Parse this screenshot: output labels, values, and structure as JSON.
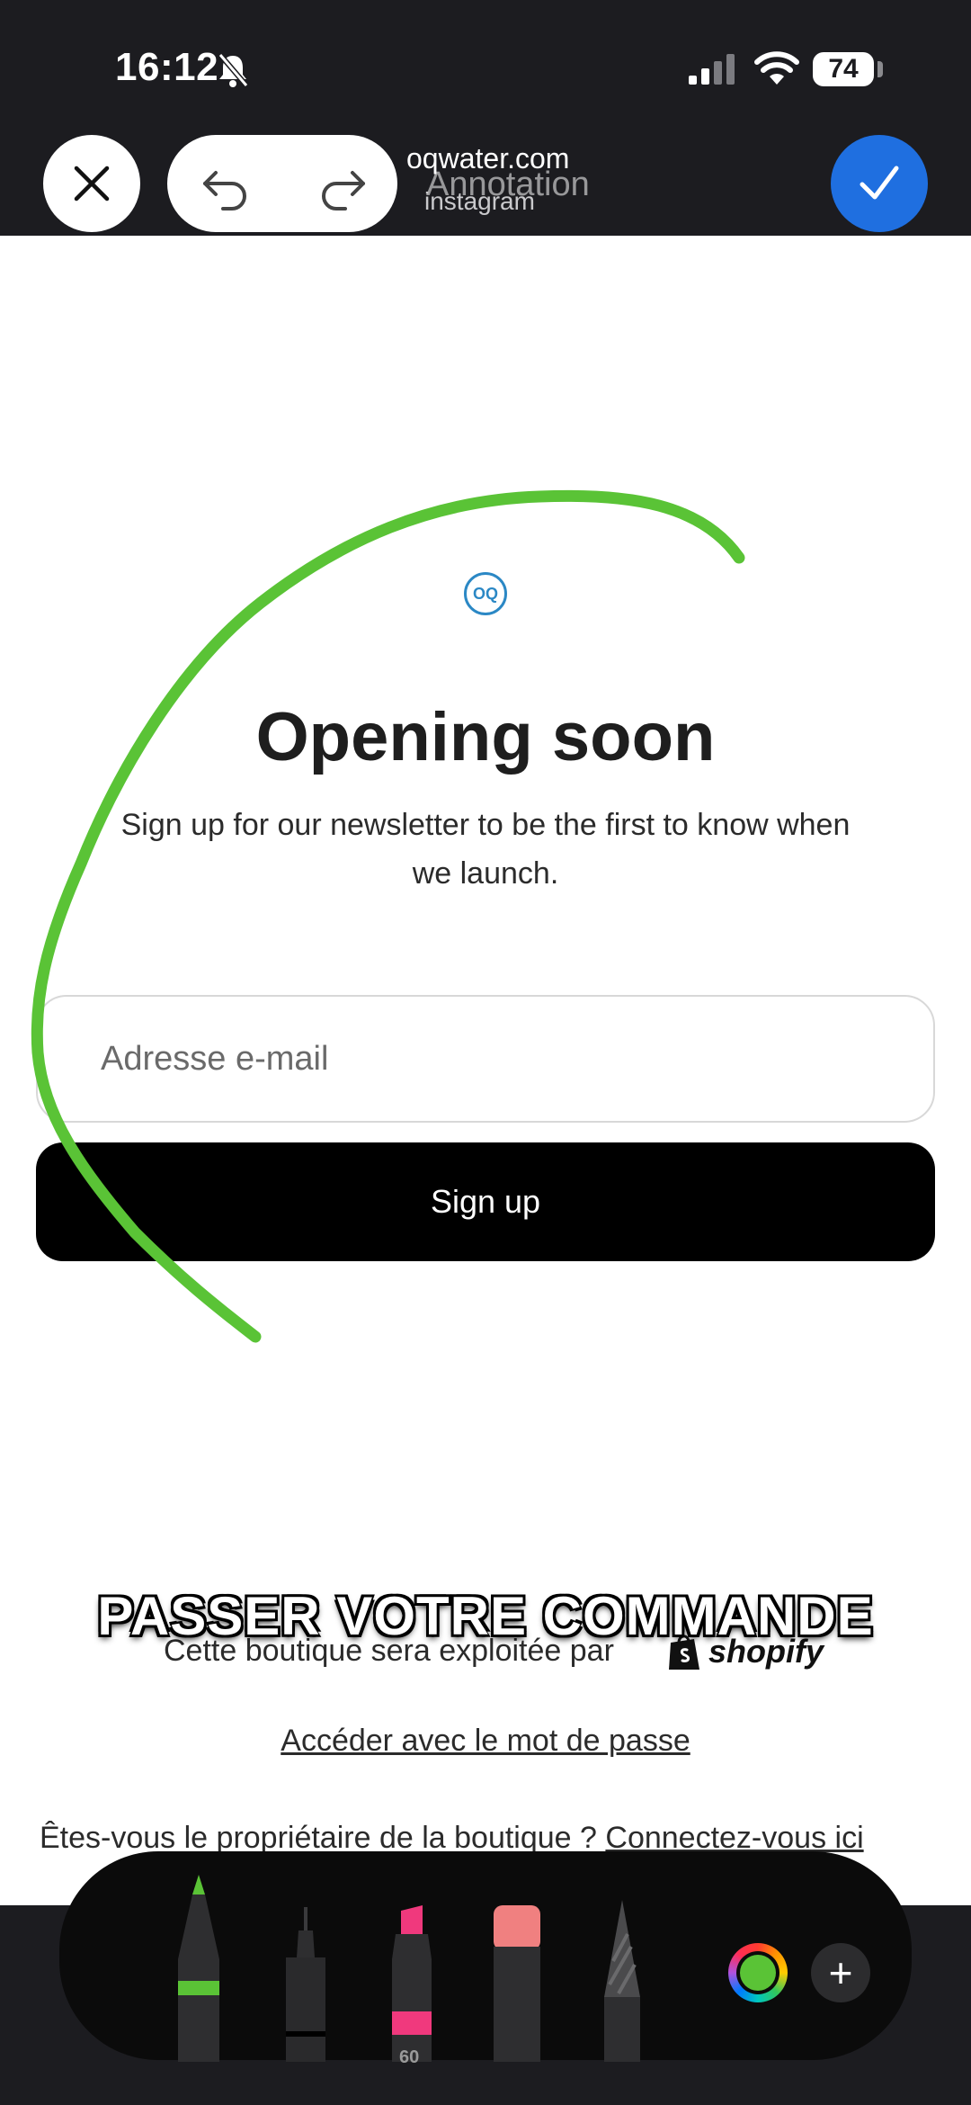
{
  "status_bar": {
    "time": "16:12",
    "battery": "74",
    "icons": [
      "bell-slash-icon",
      "signal-icon",
      "wifi-icon",
      "battery-icon"
    ]
  },
  "markup_toolbar": {
    "domain": "oqwater.com",
    "title": "Annotation",
    "source": "instagram",
    "icons": [
      "close-icon",
      "undo-icon",
      "redo-icon",
      "checkmark-icon"
    ],
    "done_color": "#1f6fe0"
  },
  "page": {
    "logo_text": "OQ",
    "headline": "Opening soon",
    "subtitle": "Sign up for our newsletter to be the first to know when we launch.",
    "email_placeholder": "Adresse e-mail",
    "signup_label": "Sign up",
    "shop_text": "Cette boutique sera exploitée par",
    "shopify_label": "shopify",
    "password_link": "Accéder avec le mot de passe",
    "owner_text": "Êtes-vous le propriétaire de la boutique ?",
    "owner_link": "Connectez-vous ici"
  },
  "overlay": {
    "caption": "PASSER VOTRE COMMANDE",
    "annotation_color": "#5ac336"
  },
  "tool_palette": {
    "tools": [
      "pen",
      "fineliner",
      "marker",
      "eraser",
      "pencil"
    ],
    "marker_opacity_label": "60",
    "selected_color": "#5ac336",
    "icons": [
      "color-picker-icon",
      "plus-icon"
    ]
  }
}
